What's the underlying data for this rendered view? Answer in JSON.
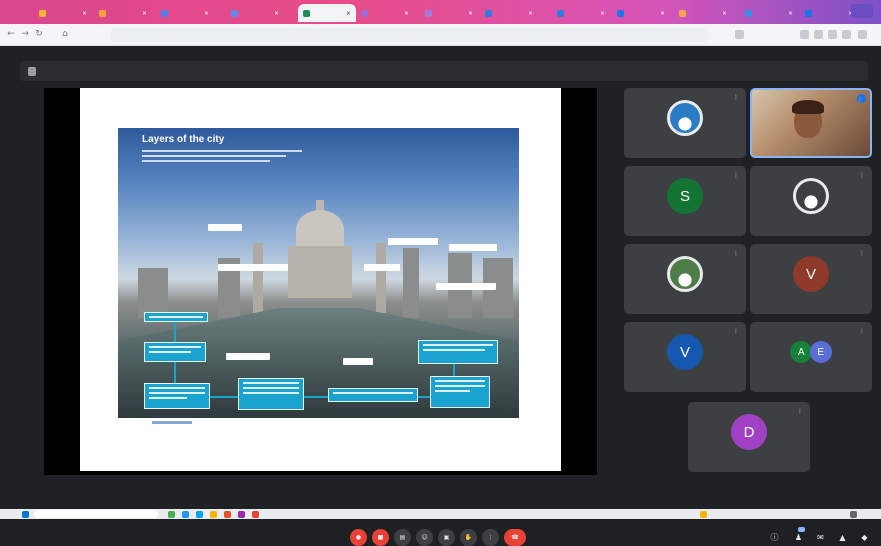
{
  "browser": {
    "active_tab_index": 4,
    "tabs": [
      {
        "label": "",
        "color": "#f2b632"
      },
      {
        "label": "",
        "color": "#f4a33b"
      },
      {
        "label": "",
        "color": "#4c7fe8"
      },
      {
        "label": "",
        "color": "#5b8de8"
      },
      {
        "label": "",
        "color": "#1f8e54"
      },
      {
        "label": "",
        "color": "#9b6fd6"
      },
      {
        "label": "",
        "color": "#a07cd8"
      },
      {
        "label": "",
        "color": "#2f7de1"
      },
      {
        "label": "",
        "color": "#2f7de1"
      },
      {
        "label": "",
        "color": "#1a73e8"
      },
      {
        "label": "",
        "color": "#f0a74a"
      },
      {
        "label": "",
        "color": "#3a8ee6"
      },
      {
        "label": "",
        "color": "#1a73e8"
      }
    ],
    "url": ""
  },
  "presentation": {
    "banner": "",
    "slide": {
      "title": "Layers of the city"
    }
  },
  "participants": [
    {
      "name": "",
      "type": "image-avatar",
      "color": "#2a7dc2"
    },
    {
      "name": "",
      "type": "video",
      "color": "#8ab4f8"
    },
    {
      "name": "",
      "type": "letter",
      "letter": "S",
      "color": "#137333"
    },
    {
      "name": "",
      "type": "image-avatar",
      "color": "#3c4043"
    },
    {
      "name": "",
      "type": "image-avatar",
      "color": "#4e7d4a"
    },
    {
      "name": "",
      "type": "letter",
      "letter": "V",
      "color": "#8e3a2a"
    },
    {
      "name": "",
      "type": "letter",
      "letter": "V",
      "color": "#1558b0"
    },
    {
      "name": "",
      "type": "pair",
      "letters": [
        "A",
        "E"
      ],
      "colors": [
        "#188038",
        "#5a6ed6"
      ]
    },
    {
      "name": "",
      "type": "letter",
      "letter": "D",
      "color": "#a142c4"
    }
  ],
  "controls": {
    "meeting_code": "",
    "end_call_color": "#ea4335"
  }
}
